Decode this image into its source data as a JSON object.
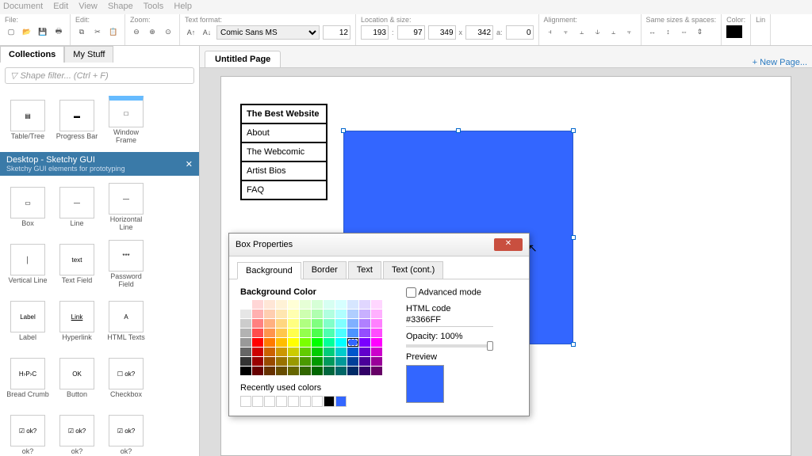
{
  "menu": [
    "Document",
    "Edit",
    "View",
    "Shape",
    "Tools",
    "Help"
  ],
  "toolbar": {
    "groups": [
      "File:",
      "Edit:",
      "Zoom:",
      "Text format:",
      "Location & size:",
      "Alignment:",
      "Same sizes & spaces:",
      "Color:",
      "Lin"
    ],
    "font": "Comic Sans MS",
    "font_size": "12",
    "loc_x": "193",
    "loc_y": "97",
    "w": "349",
    "h": "342",
    "a": "0"
  },
  "sidebar": {
    "tabs": [
      "Collections",
      "My Stuff"
    ],
    "filter_placeholder": "Shape filter... (Ctrl + F)",
    "top_items": [
      "Table/Tree",
      "Progress Bar",
      "Window Frame"
    ],
    "collection_title": "Desktop - Sketchy GUI",
    "collection_sub": "Sketchy GUI elements for prototyping",
    "items": [
      "Box",
      "Line",
      "Horizontal Line",
      "Vertical Line",
      "Text Field",
      "Password Field",
      "Label",
      "Hyperlink",
      "HTML Texts",
      "Bread Crumb",
      "Button",
      "Checkbox",
      "ok?",
      "ok?",
      "ok?"
    ]
  },
  "page_tab": "Untitled Page",
  "new_page": "New Page...",
  "mockup": {
    "title": "The Best Website",
    "items": [
      "About",
      "The Webcomic",
      "Artist Bios",
      "FAQ"
    ]
  },
  "dialog": {
    "title": "Box Properties",
    "tabs": [
      "Background",
      "Border",
      "Text",
      "Text (cont.)"
    ],
    "bg_label": "Background Color",
    "adv_mode": "Advanced mode",
    "html_label": "HTML code",
    "html_value": "#3366FF",
    "opacity_label": "Opacity: 100%",
    "preview_label": "Preview",
    "recent_label": "Recently used colors"
  },
  "palette_colors": [
    "#ffffff",
    "#ffd6d6",
    "#ffe6d6",
    "#fff2d6",
    "#ffffd6",
    "#e6ffd6",
    "#d6ffd6",
    "#d6fff2",
    "#d6ffff",
    "#d6e6ff",
    "#e0d6ff",
    "#ffd6ff",
    "#e6e6e6",
    "#ffb0b0",
    "#ffceb0",
    "#ffe6b0",
    "#ffffb0",
    "#ceffb0",
    "#b0ffb0",
    "#b0ffe0",
    "#b0ffff",
    "#b0ceff",
    "#c8b0ff",
    "#ffb0ff",
    "#cccccc",
    "#ff8080",
    "#ffb080",
    "#ffd680",
    "#ffff80",
    "#b0ff80",
    "#80ff80",
    "#80ffc8",
    "#80ffff",
    "#80b0ff",
    "#b080ff",
    "#ff80ff",
    "#b3b3b3",
    "#ff4d4d",
    "#ff944d",
    "#ffc74d",
    "#ffff4d",
    "#94ff4d",
    "#4dff4d",
    "#4dffb0",
    "#4dffff",
    "#4d94ff",
    "#944dff",
    "#ff4dff",
    "#999999",
    "#ff0000",
    "#ff7a00",
    "#ffbd00",
    "#ffff00",
    "#7aff00",
    "#00ff00",
    "#00ff99",
    "#00ffff",
    "#3366FF",
    "#7a00ff",
    "#ff00ff",
    "#666666",
    "#cc0000",
    "#cc6200",
    "#cc9700",
    "#cccc00",
    "#62cc00",
    "#00cc00",
    "#00cc7a",
    "#00cccc",
    "#0055cc",
    "#6200cc",
    "#cc00cc",
    "#333333",
    "#990000",
    "#994a00",
    "#997200",
    "#999900",
    "#4a9900",
    "#009900",
    "#00995c",
    "#009999",
    "#003f99",
    "#4a0099",
    "#990099",
    "#000000",
    "#660000",
    "#663100",
    "#664c00",
    "#666600",
    "#316600",
    "#006600",
    "#00663d",
    "#006666",
    "#002a66",
    "#310066",
    "#660066"
  ],
  "recent_colors": [
    "",
    "",
    "",
    "",
    "",
    "",
    "",
    "#000000",
    "#3366FF"
  ]
}
